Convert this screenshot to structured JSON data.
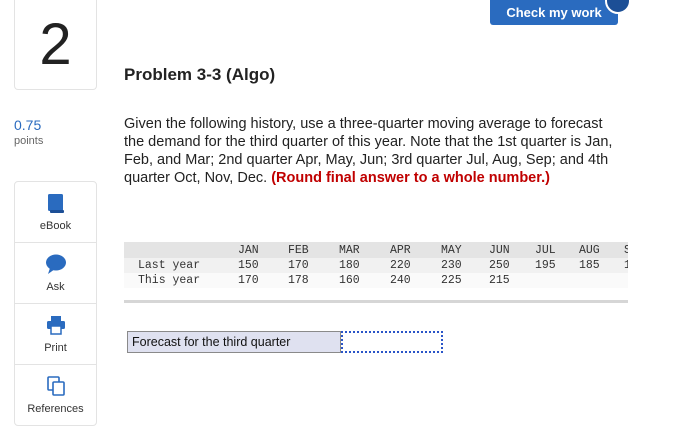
{
  "question": {
    "number": "2",
    "points_value": "0.75",
    "points_label": "points"
  },
  "header": {
    "check_button": "Check my work"
  },
  "tools": [
    {
      "label": "eBook",
      "icon": "book-icon"
    },
    {
      "label": "Ask",
      "icon": "chat-bubble-icon"
    },
    {
      "label": "Print",
      "icon": "printer-icon"
    },
    {
      "label": "References",
      "icon": "copy-icon"
    }
  ],
  "problem": {
    "title": "Problem 3-3 (Algo)",
    "text": "Given the following history, use a three-quarter moving average to forecast the demand for the third quarter of this year. Note that the 1st quarter is Jan, Feb, and Mar; 2nd quarter Apr, May, Jun; 3rd quarter Jul, Aug, Sep; and 4th quarter Oct, Nov, Dec.",
    "emphasis": "(Round final answer to a whole number.)"
  },
  "table": {
    "months": [
      "JAN",
      "FEB",
      "MAR",
      "APR",
      "MAY",
      "JUN",
      "JUL",
      "AUG",
      "S"
    ],
    "rows": [
      {
        "label": "Last year",
        "values": [
          "150",
          "170",
          "180",
          "220",
          "230",
          "250",
          "195",
          "185",
          "1"
        ]
      },
      {
        "label": "This year",
        "values": [
          "170",
          "178",
          "160",
          "240",
          "225",
          "215",
          "",
          "",
          ""
        ]
      }
    ]
  },
  "answer": {
    "label": "Forecast for the third quarter",
    "value": ""
  },
  "colors": {
    "accent": "#2a6bbf",
    "emphasis": "#c00000",
    "answer_label_bg": "#dfe1f0"
  }
}
